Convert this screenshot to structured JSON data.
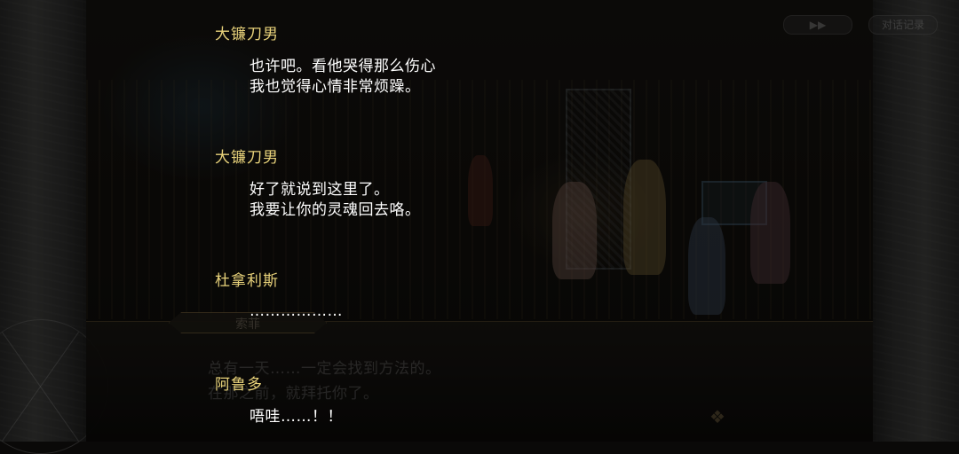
{
  "controls": {
    "fast_forward_label": "▶▶",
    "log_label": "对话记录"
  },
  "scene_dialogue": {
    "speaker": "索菲",
    "lines": [
      "总有一天……一定会找到方法的。",
      "在那之前，就拜托你了。"
    ]
  },
  "log": {
    "entries": [
      {
        "speaker": "大镰刀男",
        "text": "也许吧。看他哭得那么伤心\n我也觉得心情非常烦躁。"
      },
      {
        "speaker": "大镰刀男",
        "text": "好了就说到这里了。\n我要让你的灵魂回去咯。"
      },
      {
        "speaker": "杜拿利斯",
        "text": "………………"
      },
      {
        "speaker": "阿鲁多",
        "text": "唔哇……！！"
      }
    ]
  }
}
